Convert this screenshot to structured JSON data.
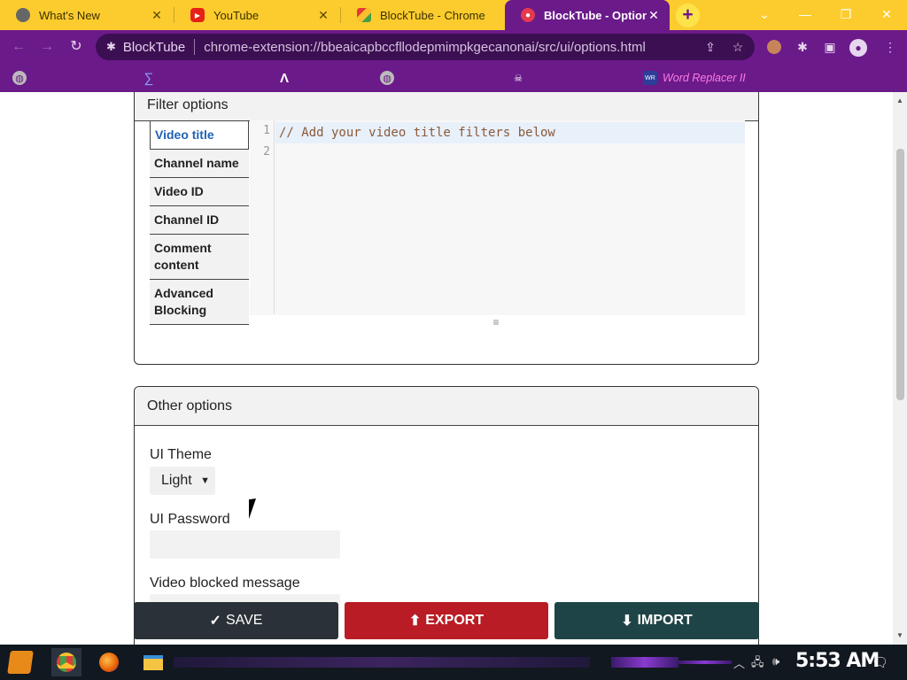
{
  "browser": {
    "tabs": [
      {
        "title": "What's New",
        "favicon": "chrome-icon"
      },
      {
        "title": "YouTube",
        "favicon": "youtube-icon"
      },
      {
        "title": "BlockTube - Chrome",
        "favicon": "webstore-icon"
      },
      {
        "title": "BlockTube - Options",
        "favicon": "blocktube-icon",
        "active": true
      }
    ],
    "new_tab": "+",
    "omnibox": {
      "site_label": "BlockTube",
      "url": "chrome-extension://bbeaicapbccfllodepmimpkgecanonai/src/ui/options.html"
    },
    "bookmarks": [
      {
        "label": "",
        "icon": "globe-icon"
      },
      {
        "label": "",
        "icon": "sigma-icon"
      },
      {
        "label": "",
        "icon": "lambda-icon"
      },
      {
        "label": "",
        "icon": "globe-icon"
      },
      {
        "label": "",
        "icon": "skull-icon"
      },
      {
        "label": "Word Replacer II",
        "icon": "wr-icon"
      }
    ]
  },
  "filter_options": {
    "header": "Filter options",
    "tabs": [
      {
        "label": "Video title",
        "active": true
      },
      {
        "label": "Channel name"
      },
      {
        "label": "Video ID"
      },
      {
        "label": "Channel ID"
      },
      {
        "label": "Comment content"
      },
      {
        "label": "Advanced Blocking"
      }
    ],
    "editor": {
      "lines": [
        {
          "number": "1",
          "text": "// Add your video title filters below"
        },
        {
          "number": "2",
          "text": ""
        }
      ],
      "resize_handle": "≡"
    }
  },
  "other_options": {
    "header": "Other options",
    "theme_label": "UI Theme",
    "theme_value": "Light",
    "password_label": "UI Password",
    "blocked_message_label": "Video blocked message"
  },
  "actions": {
    "save": {
      "icon": "✓",
      "label": "SAVE",
      "color": "#2b3138"
    },
    "export": {
      "icon": "⬆",
      "label": "EXPORT",
      "color": "#b91c24"
    },
    "import": {
      "icon": "⬇",
      "label": "IMPORT",
      "color": "#1f4447"
    }
  },
  "taskbar": {
    "clock": "5:53 AM"
  },
  "colors": {
    "tab_strip": "#fccc2e",
    "toolbar": "#6b1a8a",
    "bookmark_text": "#ff7be3",
    "active_filter_tab": "#1f62b5"
  }
}
